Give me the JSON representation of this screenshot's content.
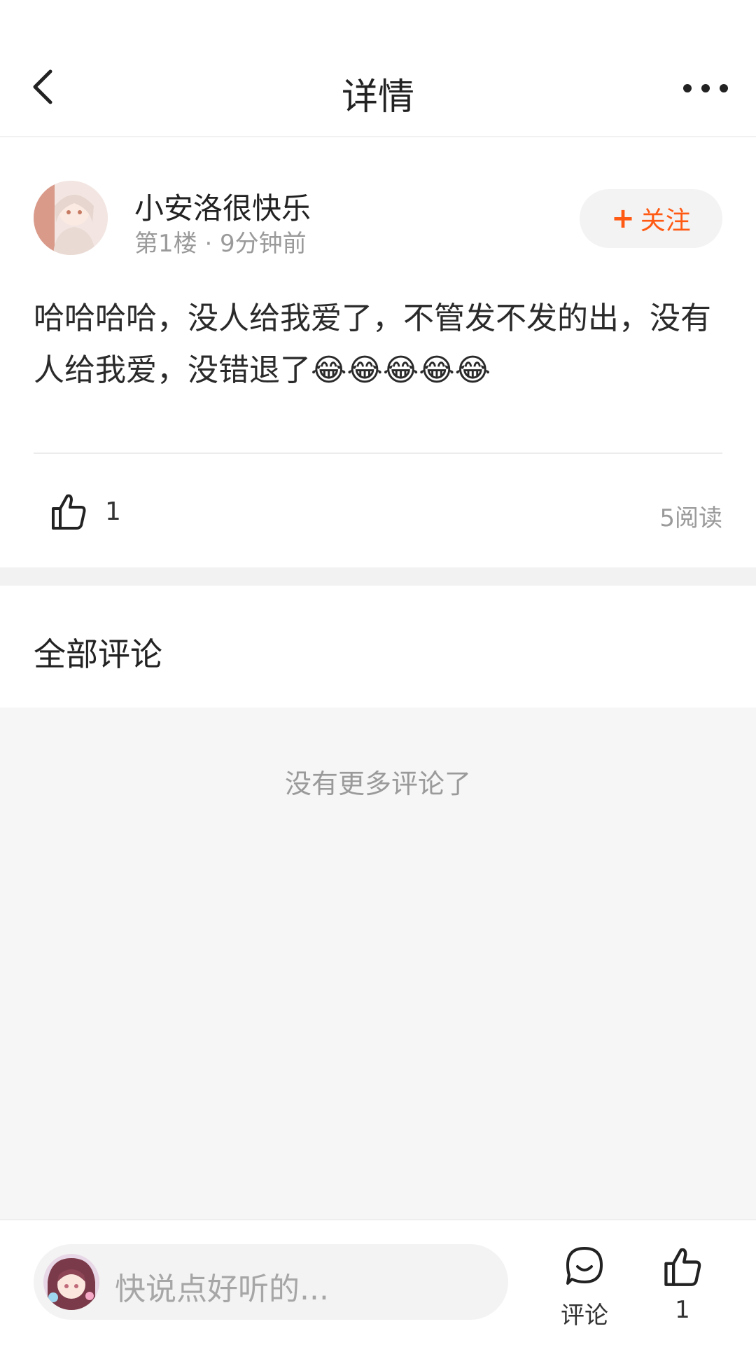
{
  "header": {
    "title": "详情",
    "back_icon": "chevron-left-icon",
    "more_icon": "more-horizontal-icon"
  },
  "post": {
    "author_name": "小安洛很快乐",
    "meta": "第1楼 · 9分钟前",
    "follow_label": "关注",
    "text": "哈哈哈哈，没人给我爱了，不管发不发的出，没有人给我爱，没错退了😂😂😂😂😂",
    "like_count": "1",
    "read_count": "5阅读"
  },
  "comments": {
    "section_title": "全部评论",
    "empty_text": "没有更多评论了"
  },
  "bottom_bar": {
    "input_placeholder": "快说点好听的...",
    "comment_label": "评论",
    "like_count": "1"
  },
  "colors": {
    "accent": "#ff5a14",
    "muted_text": "#9a9a9a",
    "background_gray": "#f6f6f6"
  }
}
